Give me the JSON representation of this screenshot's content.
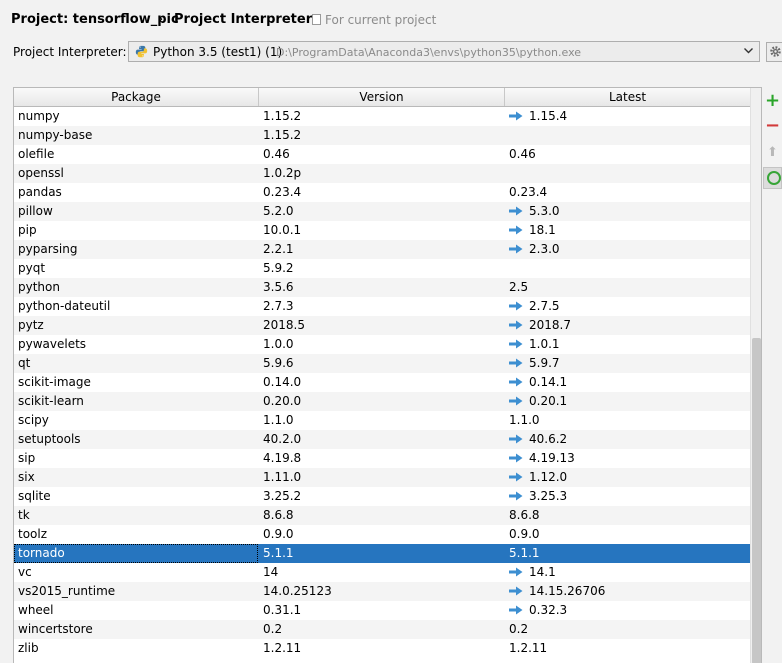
{
  "breadcrumb": {
    "project": "Project: tensorflow_pic",
    "separator": "›",
    "page": "Project Interpreter",
    "scope": "For current project"
  },
  "interpreter": {
    "label": "Project Interpreter:",
    "name": "Python 3.5 (test1) (1)",
    "path": "D:\\ProgramData\\Anaconda3\\envs\\python35\\python.exe"
  },
  "table": {
    "columns": [
      "Package",
      "Version",
      "Latest"
    ],
    "rows": [
      {
        "package": "numpy",
        "version": "1.15.2",
        "latest": "1.15.4",
        "upgrade": true
      },
      {
        "package": "numpy-base",
        "version": "1.15.2",
        "latest": "",
        "upgrade": false
      },
      {
        "package": "olefile",
        "version": "0.46",
        "latest": "0.46",
        "upgrade": false
      },
      {
        "package": "openssl",
        "version": "1.0.2p",
        "latest": "",
        "upgrade": false
      },
      {
        "package": "pandas",
        "version": "0.23.4",
        "latest": "0.23.4",
        "upgrade": false
      },
      {
        "package": "pillow",
        "version": "5.2.0",
        "latest": "5.3.0",
        "upgrade": true
      },
      {
        "package": "pip",
        "version": "10.0.1",
        "latest": "18.1",
        "upgrade": true
      },
      {
        "package": "pyparsing",
        "version": "2.2.1",
        "latest": "2.3.0",
        "upgrade": true
      },
      {
        "package": "pyqt",
        "version": "5.9.2",
        "latest": "",
        "upgrade": false
      },
      {
        "package": "python",
        "version": "3.5.6",
        "latest": "2.5",
        "upgrade": false
      },
      {
        "package": "python-dateutil",
        "version": "2.7.3",
        "latest": "2.7.5",
        "upgrade": true
      },
      {
        "package": "pytz",
        "version": "2018.5",
        "latest": "2018.7",
        "upgrade": true
      },
      {
        "package": "pywavelets",
        "version": "1.0.0",
        "latest": "1.0.1",
        "upgrade": true
      },
      {
        "package": "qt",
        "version": "5.9.6",
        "latest": "5.9.7",
        "upgrade": true
      },
      {
        "package": "scikit-image",
        "version": "0.14.0",
        "latest": "0.14.1",
        "upgrade": true
      },
      {
        "package": "scikit-learn",
        "version": "0.20.0",
        "latest": "0.20.1",
        "upgrade": true
      },
      {
        "package": "scipy",
        "version": "1.1.0",
        "latest": "1.1.0",
        "upgrade": false
      },
      {
        "package": "setuptools",
        "version": "40.2.0",
        "latest": "40.6.2",
        "upgrade": true
      },
      {
        "package": "sip",
        "version": "4.19.8",
        "latest": "4.19.13",
        "upgrade": true
      },
      {
        "package": "six",
        "version": "1.11.0",
        "latest": "1.12.0",
        "upgrade": true
      },
      {
        "package": "sqlite",
        "version": "3.25.2",
        "latest": "3.25.3",
        "upgrade": true
      },
      {
        "package": "tk",
        "version": "8.6.8",
        "latest": "8.6.8",
        "upgrade": false
      },
      {
        "package": "toolz",
        "version": "0.9.0",
        "latest": "0.9.0",
        "upgrade": false
      },
      {
        "package": "tornado",
        "version": "5.1.1",
        "latest": "5.1.1",
        "upgrade": false,
        "selected": true
      },
      {
        "package": "vc",
        "version": "14",
        "latest": "14.1",
        "upgrade": true
      },
      {
        "package": "vs2015_runtime",
        "version": "14.0.25123",
        "latest": "14.15.26706",
        "upgrade": true
      },
      {
        "package": "wheel",
        "version": "0.31.1",
        "latest": "0.32.3",
        "upgrade": true
      },
      {
        "package": "wincertstore",
        "version": "0.2",
        "latest": "0.2",
        "upgrade": false
      },
      {
        "package": "zlib",
        "version": "1.2.11",
        "latest": "1.2.11",
        "upgrade": false
      }
    ]
  },
  "tools": {
    "add": "+",
    "remove": "−",
    "upgrade": "⬆"
  },
  "colors": {
    "selection": "#2675bf",
    "upgrade_arrow": "#3d8fd1",
    "add": "#2aa52a",
    "remove": "#d23a3a"
  },
  "icons": {
    "python": "python-icon",
    "dropdown": "chevron-down-icon",
    "gear": "gear-icon",
    "upgrade_available": "arrow-right-icon",
    "refresh": "refresh-icon"
  }
}
